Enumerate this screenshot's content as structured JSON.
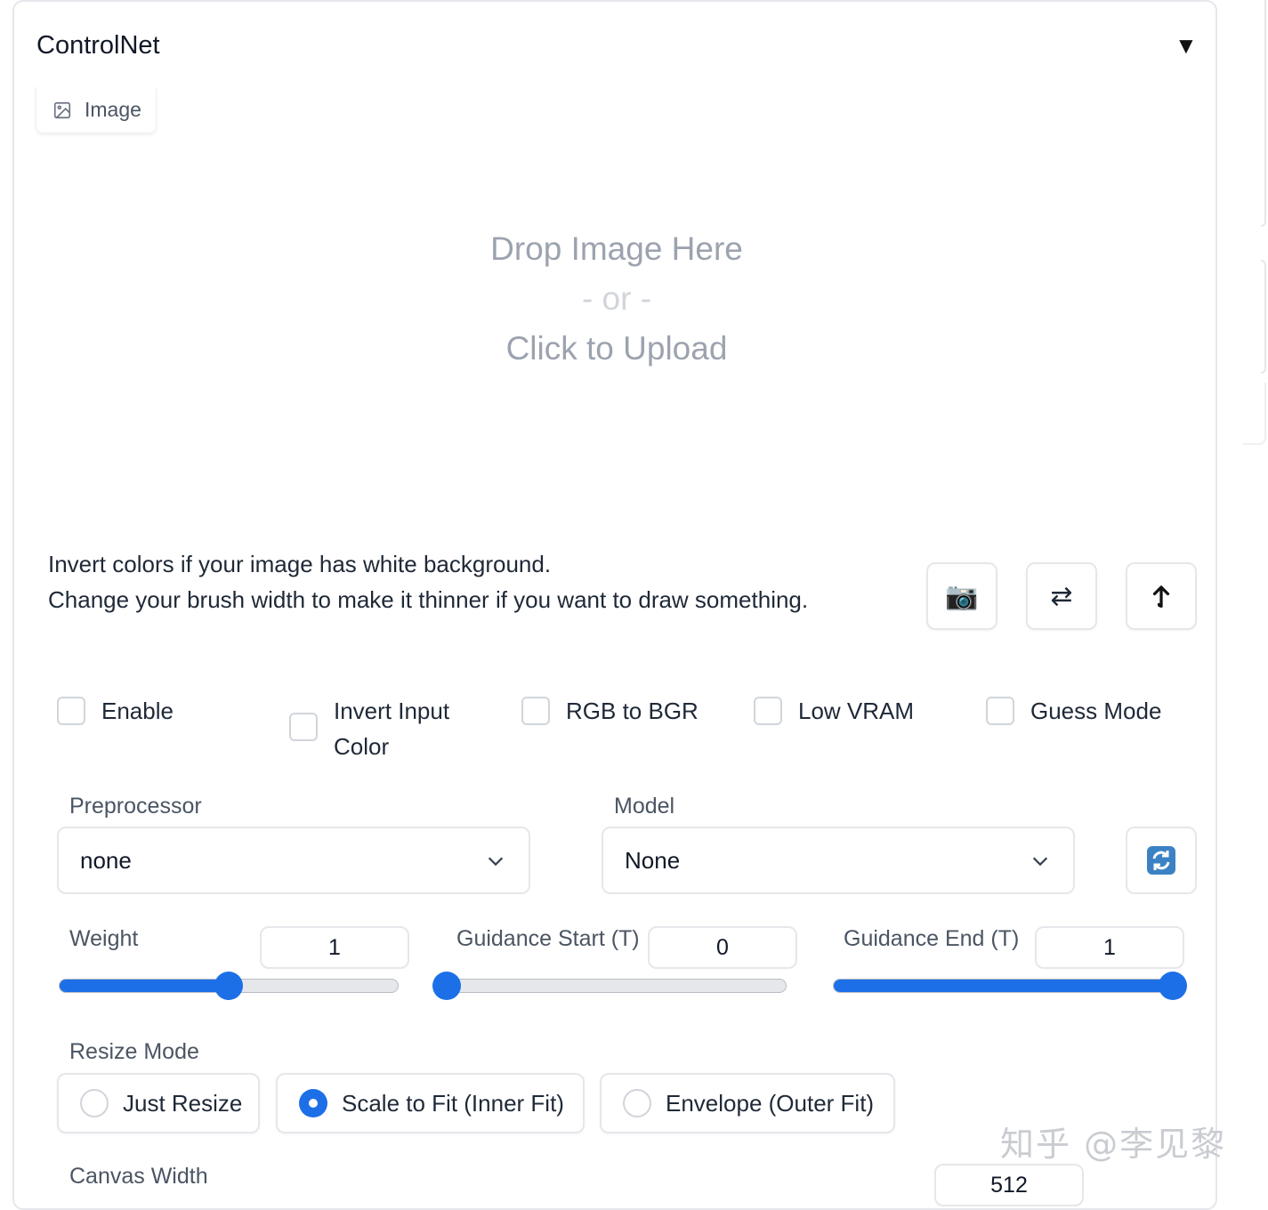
{
  "panel": {
    "title": "ControlNet",
    "collapse_icon": "▼"
  },
  "image_tab": {
    "label": "Image",
    "icon": "image-icon"
  },
  "dropzone": {
    "line1": "Drop Image Here",
    "line2": "- or -",
    "line3": "Click to Upload"
  },
  "hint": {
    "line1": "Invert colors if your image has white background.",
    "line2": "Change your brush width to make it thinner if you want to draw something."
  },
  "tool_buttons": [
    {
      "name": "camera-button",
      "icon": "camera-icon",
      "glyph": "📷"
    },
    {
      "name": "swap-button",
      "icon": "swap-arrows-icon",
      "glyph": "⇄"
    },
    {
      "name": "send-up-button",
      "icon": "up-arrow-icon",
      "glyph": "⮥"
    }
  ],
  "checkboxes": [
    {
      "label": "Enable",
      "checked": false
    },
    {
      "label": "Invert Input Color",
      "line1": "Invert Input",
      "line2": "Color",
      "checked": false
    },
    {
      "label": "RGB to BGR",
      "checked": false
    },
    {
      "label": "Low VRAM",
      "checked": false
    },
    {
      "label": "Guess Mode",
      "checked": false
    }
  ],
  "preprocessor": {
    "label": "Preprocessor",
    "value": "none"
  },
  "model": {
    "label": "Model",
    "value": "None"
  },
  "refresh_icon": "refresh-icon",
  "sliders": {
    "weight": {
      "label": "Weight",
      "value": "1",
      "min": 0,
      "max": 2,
      "fraction": 0.5
    },
    "guidance_start": {
      "label": "Guidance Start (T)",
      "value": "0",
      "min": 0,
      "max": 1,
      "fraction": 0.0
    },
    "guidance_end": {
      "label": "Guidance End (T)",
      "value": "1",
      "min": 0,
      "max": 1,
      "fraction": 1.0
    }
  },
  "resize_mode": {
    "label": "Resize Mode",
    "options": [
      "Just Resize",
      "Scale to Fit (Inner Fit)",
      "Envelope (Outer Fit)"
    ],
    "selected": "Scale to Fit (Inner Fit)"
  },
  "canvas_width": {
    "label": "Canvas Width",
    "value": "512"
  },
  "colors": {
    "accent": "#1d6fe8",
    "border": "#e5e7eb"
  },
  "watermark": "知乎 @李见黎"
}
